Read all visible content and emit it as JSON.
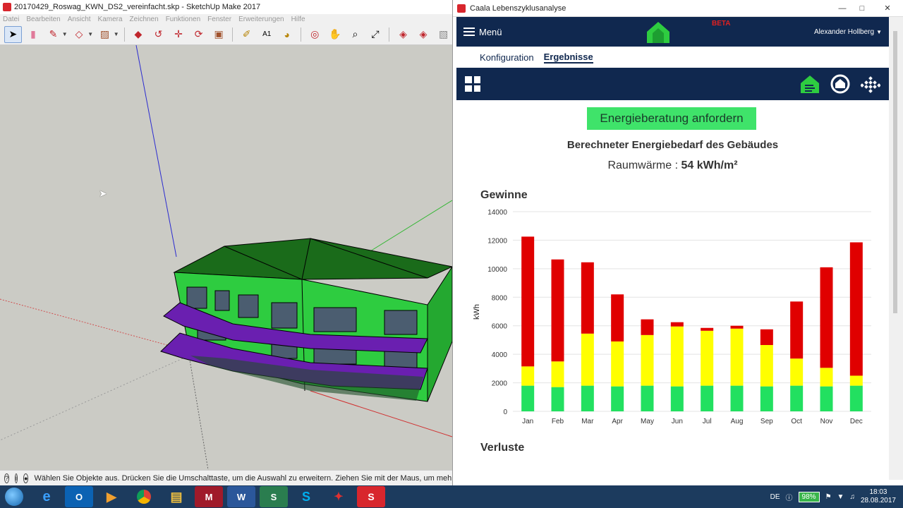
{
  "sketchup": {
    "title": "20170429_Roswag_KWN_DS2_vereinfacht.skp - SketchUp Make 2017",
    "menu": [
      "Datei",
      "Bearbeiten",
      "Ansicht",
      "Kamera",
      "Zeichnen",
      "Funktionen",
      "Fenster",
      "Erweiterungen",
      "Hilfe"
    ],
    "status_text": "Wählen Sie Objekte aus. Drücken Sie die Umschalttaste, um die Auswahl zu erweitern. Ziehen Sie mit der Maus, um mehre"
  },
  "caala": {
    "window_title": "Caala Lebenszyklusanalyse",
    "menu_label": "Menü",
    "beta": "BETA",
    "user": "Alexander Hollberg",
    "tabs": [
      {
        "label": "Konfiguration",
        "active": false
      },
      {
        "label": "Ergebnisse",
        "active": true
      }
    ],
    "cta_label": "Energieberatung anfordern",
    "calc_title": "Berechneter Energiebedarf des Gebäudes",
    "raumwaerme_label": "Raumwärme :",
    "raumwaerme_value": "54 kWh/m²",
    "gains_title": "Gewinne",
    "losses_title": "Verluste"
  },
  "chart_data": {
    "type": "bar",
    "stacked": true,
    "categories": [
      "Jan",
      "Feb",
      "Mar",
      "Apr",
      "May",
      "Jun",
      "Jul",
      "Aug",
      "Sep",
      "Oct",
      "Nov",
      "Dec"
    ],
    "series": [
      {
        "color": "#22e060",
        "values": [
          1800,
          1700,
          1800,
          1750,
          1800,
          1750,
          1800,
          1800,
          1750,
          1800,
          1750,
          1800
        ]
      },
      {
        "color": "#ffff00",
        "values": [
          1350,
          1800,
          3650,
          3150,
          3550,
          4200,
          3850,
          4000,
          2900,
          1900,
          1300,
          700
        ]
      },
      {
        "color": "#e00000",
        "values": [
          9100,
          7150,
          5000,
          3300,
          1100,
          300,
          200,
          200,
          1100,
          4000,
          7050,
          9350
        ]
      }
    ],
    "ylabel": "kWh",
    "ylim": [
      0,
      14000
    ],
    "yticks": [
      0,
      2000,
      4000,
      6000,
      8000,
      10000,
      12000,
      14000
    ],
    "grid": true
  },
  "taskbar": {
    "lang": "DE",
    "battery": "98%",
    "time": "18:03",
    "date": "28.08.2017"
  }
}
